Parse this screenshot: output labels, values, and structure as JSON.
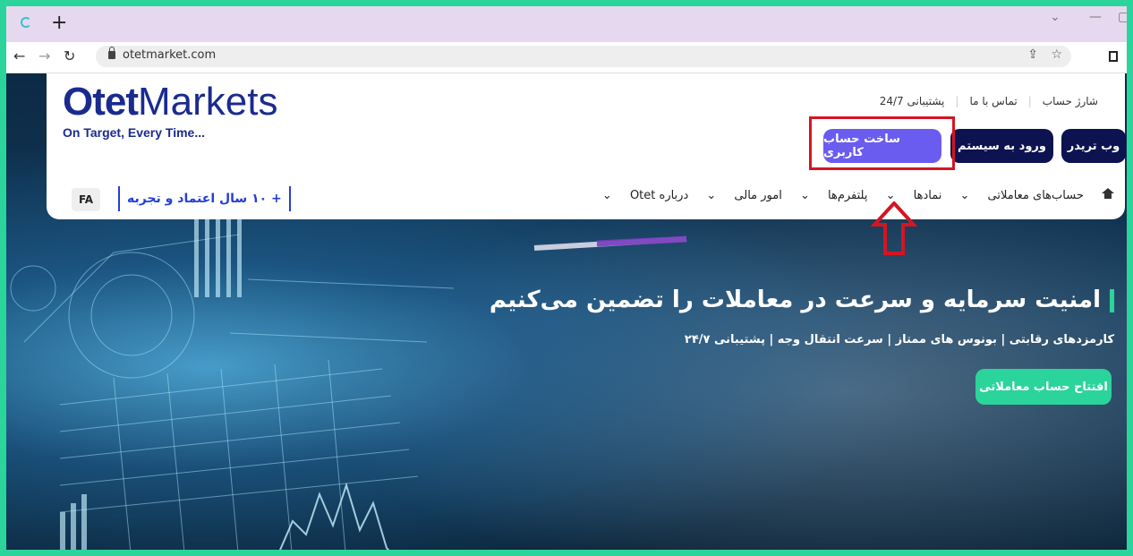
{
  "browser": {
    "url": "otetmarket.com",
    "new_tab": "+",
    "icons": [
      "back-arrow-icon",
      "forward-arrow-icon",
      "reload-icon",
      "share-icon",
      "star-icon",
      "menu-icon"
    ]
  },
  "logo": {
    "name_bold": "Otet",
    "name_light": "Markets",
    "tagline": "On Target, Every Time..."
  },
  "top_links": [
    "شارژ حساب",
    "تماس با ما",
    "پشتیبانی 24/7"
  ],
  "buttons": {
    "webtrader": "وب تریدر",
    "login": "ورود به سیستم",
    "signup": "ساخت حساب کاربری"
  },
  "nav": [
    "حساب‌های معاملاتی",
    "نمادها",
    "پلتفرم‌ها",
    "امور مالی",
    "درباره Otet"
  ],
  "years_badge": "+ ۱۰ سال اعتماد و تجربه",
  "language": "FA",
  "hero": {
    "headline": "امنیت سرمایه و سرعت در معاملات را تضمین می‌کنیم",
    "subline": "کارمزدهای رقابتی | بونوس های ممتاز | سرعت انتقال وجه | پشتیبانی ۲۴/۷",
    "cta": "افتتاح حساب معاملاتی"
  },
  "colors": {
    "frame": "#2bd49a",
    "navy": "#0c1350",
    "purple": "#6b5cf0",
    "green": "#2bd49a",
    "highlight_red": "#d41522"
  }
}
